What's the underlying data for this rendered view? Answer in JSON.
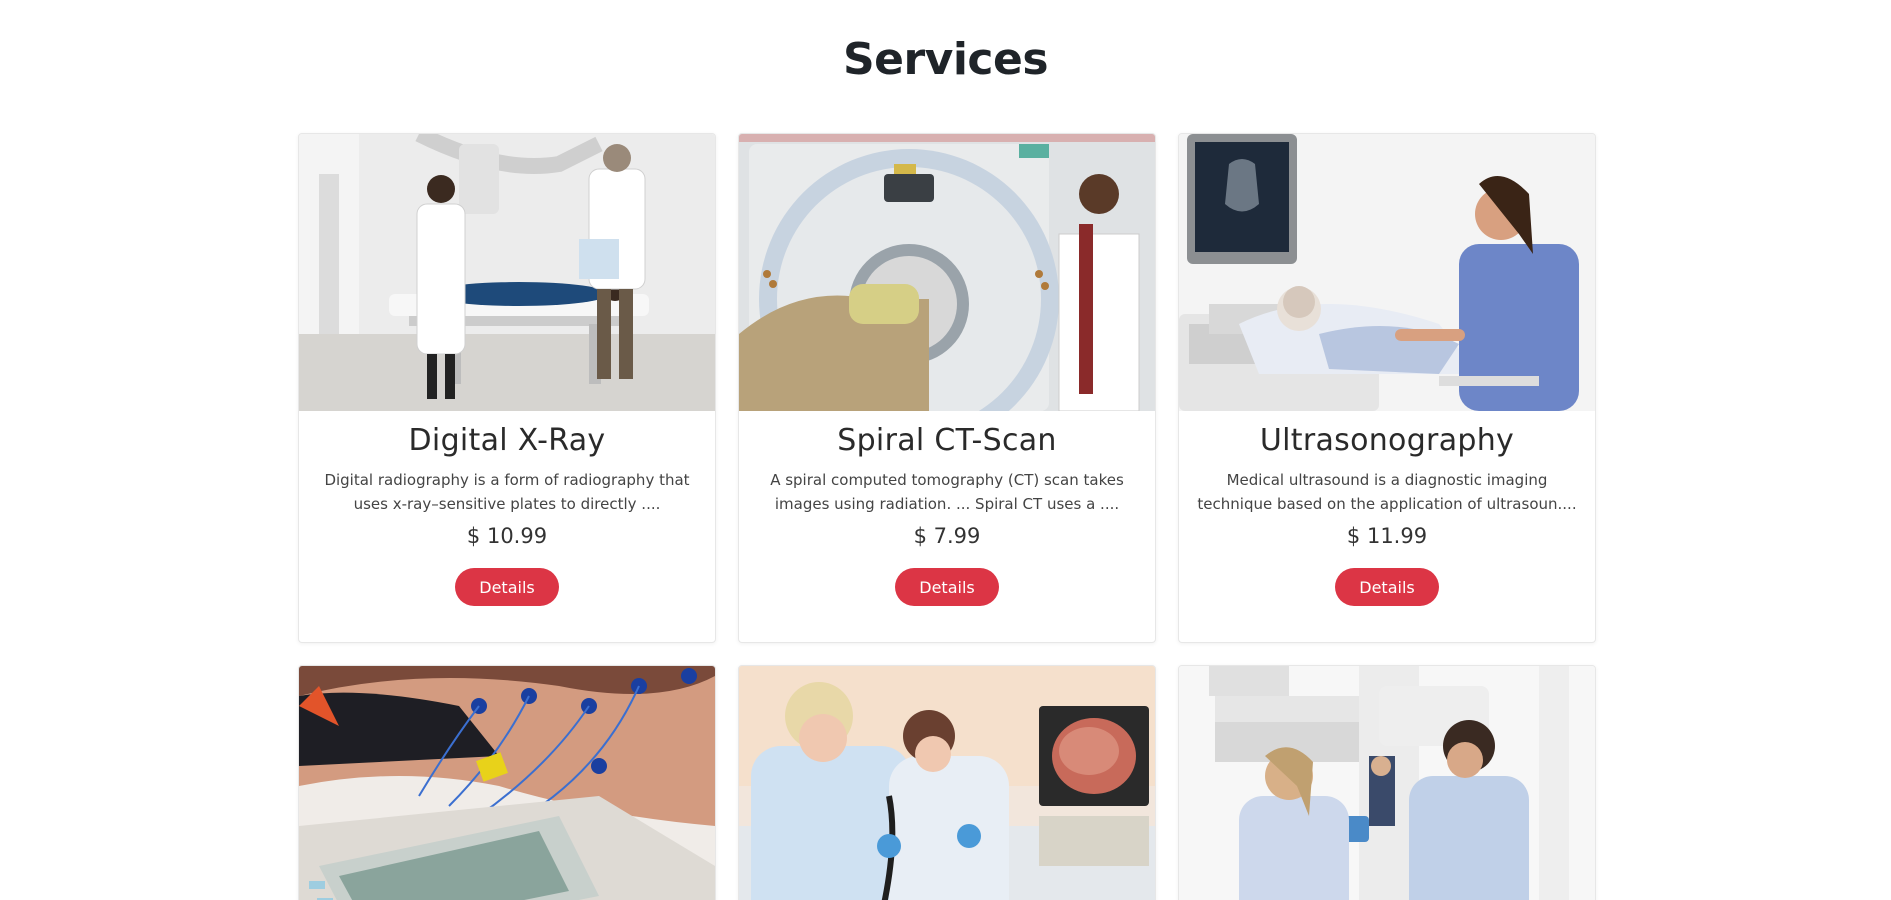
{
  "section": {
    "title": "Services"
  },
  "services": [
    {
      "title": "Digital X-Ray",
      "description": "Digital radiography is a form of radiography that uses x-ray–sensitive plates to directly ....",
      "price": "$ 10.99",
      "button_label": "Details",
      "image_alt": "Digital X-Ray"
    },
    {
      "title": "Spiral CT-Scan",
      "description": "A spiral computed tomography (CT) scan takes images using radiation. ... Spiral CT uses a ....",
      "price": "$ 7.99",
      "button_label": "Details",
      "image_alt": "Spiral CT-Scan"
    },
    {
      "title": "Ultrasonography",
      "description": "Medical ultrasound is a diagnostic imaging technique based on the application of ultrasoun....",
      "price": "$ 11.99",
      "button_label": "Details",
      "image_alt": "Ultrasonography"
    },
    {
      "image_alt": "ECG"
    },
    {
      "image_alt": "Endoscopy"
    },
    {
      "image_alt": "Dental X-Ray"
    }
  ],
  "colors": {
    "accent": "#dc3545",
    "title": "#1f2429",
    "card_border": "#e7e7e7"
  }
}
